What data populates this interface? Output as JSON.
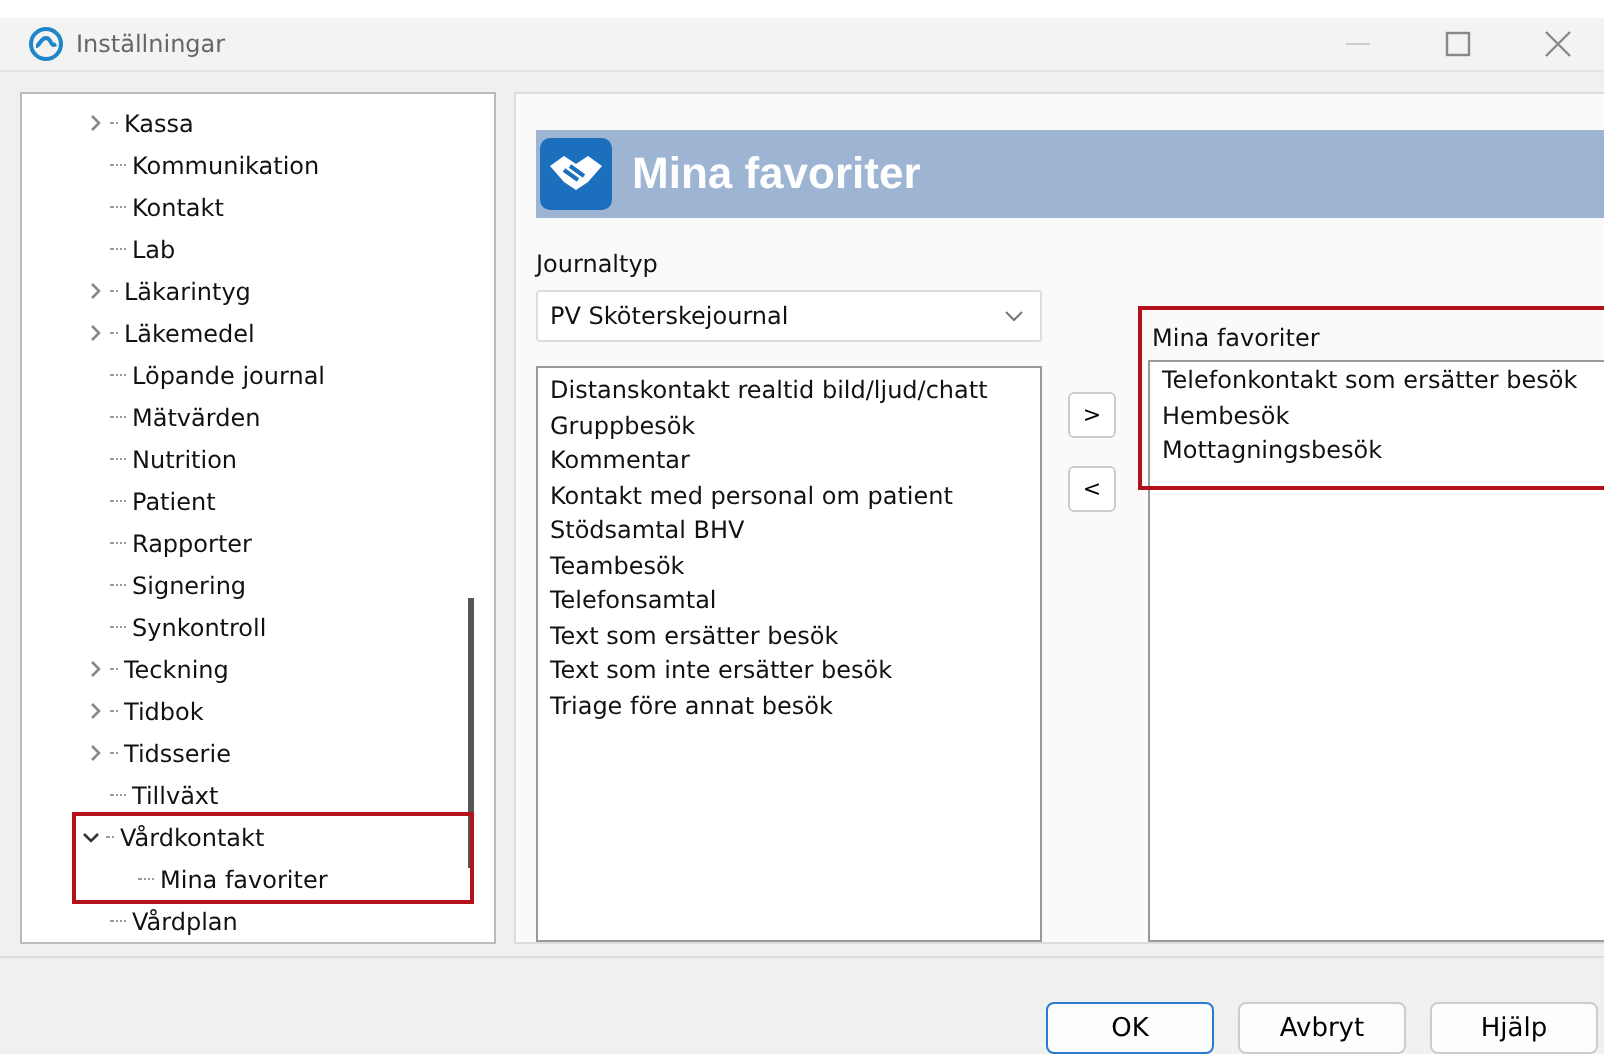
{
  "window": {
    "title": "Inställningar"
  },
  "tree": {
    "items": [
      {
        "label": "Kassa",
        "kind": "branch",
        "expanded": false
      },
      {
        "label": "Kommunikation",
        "kind": "leaf"
      },
      {
        "label": "Kontakt",
        "kind": "leaf"
      },
      {
        "label": "Lab",
        "kind": "leaf"
      },
      {
        "label": "Läkarintyg",
        "kind": "branch",
        "expanded": false
      },
      {
        "label": "Läkemedel",
        "kind": "branch",
        "expanded": false
      },
      {
        "label": "Löpande journal",
        "kind": "leaf"
      },
      {
        "label": "Mätvärden",
        "kind": "leaf"
      },
      {
        "label": "Nutrition",
        "kind": "leaf"
      },
      {
        "label": "Patient",
        "kind": "leaf"
      },
      {
        "label": "Rapporter",
        "kind": "leaf"
      },
      {
        "label": "Signering",
        "kind": "leaf"
      },
      {
        "label": "Synkontroll",
        "kind": "leaf"
      },
      {
        "label": "Teckning",
        "kind": "branch",
        "expanded": false
      },
      {
        "label": "Tidbok",
        "kind": "branch",
        "expanded": false
      },
      {
        "label": "Tidsserie",
        "kind": "branch",
        "expanded": false
      },
      {
        "label": "Tillväxt",
        "kind": "leaf"
      },
      {
        "label": "Vårdkontakt",
        "kind": "branch",
        "expanded": true,
        "highlighted": true,
        "children": [
          {
            "label": "Mina favoriter",
            "kind": "leaf"
          }
        ]
      },
      {
        "label": "Vårdplan",
        "kind": "leaf"
      }
    ]
  },
  "panel": {
    "title": "Mina favoriter",
    "journaltyp": {
      "label": "Journaltyp",
      "value": "PV Sköterskejournal"
    },
    "available": [
      "Distanskontakt realtid bild/ljud/chatt",
      "Gruppbesök",
      "Kommentar",
      "Kontakt med personal om patient",
      "Stödsamtal BHV",
      "Teambesök",
      "Telefonsamtal",
      "Text som ersätter besök",
      "Text som inte ersätter besök",
      "Triage före annat besök"
    ],
    "move_buttons": [
      ">",
      "<"
    ],
    "favorites": {
      "label": "Mina favoriter",
      "highlighted": true,
      "items": [
        "Telefonkontakt som ersätter besök",
        "Hembesök",
        "Mottagningsbesök"
      ]
    }
  },
  "buttons": [
    {
      "label": "OK",
      "default": true
    },
    {
      "label": "Avbryt",
      "default": false
    },
    {
      "label": "Hjälp",
      "default": false
    }
  ]
}
